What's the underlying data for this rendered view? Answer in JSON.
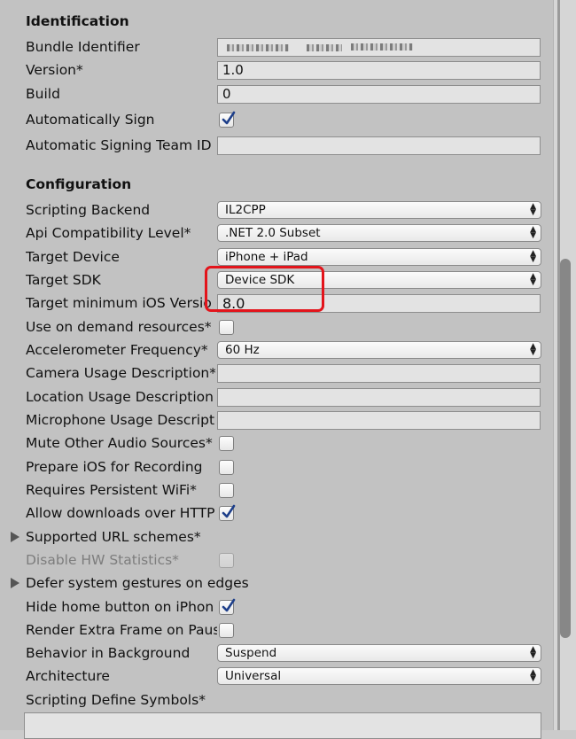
{
  "identification": {
    "heading": "Identification",
    "bundle_identifier": {
      "label": "Bundle Identifier",
      "value": ""
    },
    "version": {
      "label": "Version*",
      "value": "1.0"
    },
    "build": {
      "label": "Build",
      "value": "0"
    },
    "automatically_sign": {
      "label": "Automatically Sign",
      "checked": true
    },
    "signing_team": {
      "label": "Automatic Signing Team ID",
      "value": ""
    }
  },
  "configuration": {
    "heading": "Configuration",
    "scripting_backend": {
      "label": "Scripting Backend",
      "value": "IL2CPP"
    },
    "api_compat": {
      "label": "Api Compatibility Level*",
      "value": ".NET 2.0 Subset"
    },
    "target_device": {
      "label": "Target Device",
      "value": "iPhone + iPad"
    },
    "target_sdk": {
      "label": "Target SDK",
      "value": "Device SDK"
    },
    "target_min_ios": {
      "label": "Target minimum iOS Versio",
      "value": "8.0"
    },
    "on_demand": {
      "label": "Use on demand resources*",
      "checked": false
    },
    "accel_freq": {
      "label": "Accelerometer Frequency*",
      "value": "60 Hz"
    },
    "camera_desc": {
      "label": "Camera Usage Description*",
      "value": ""
    },
    "location_desc": {
      "label": "Location Usage Description",
      "value": ""
    },
    "mic_desc": {
      "label": "Microphone Usage Descript",
      "value": ""
    },
    "mute_audio": {
      "label": "Mute Other Audio Sources*",
      "checked": false
    },
    "prepare_recording": {
      "label": "Prepare iOS for Recording",
      "checked": false
    },
    "persistent_wifi": {
      "label": "Requires Persistent WiFi*",
      "checked": false
    },
    "allow_http": {
      "label": "Allow downloads over HTTP",
      "checked": true
    },
    "url_schemes": {
      "label": "Supported URL schemes*"
    },
    "disable_hw_stats": {
      "label": "Disable HW Statistics*",
      "checked": false
    },
    "defer_gestures": {
      "label": "Defer system gestures on edges"
    },
    "hide_home": {
      "label": "Hide home button on iPhon",
      "checked": true
    },
    "extra_frame": {
      "label": "Render Extra Frame on Paus",
      "checked": false
    },
    "background_behavior": {
      "label": "Behavior in Background",
      "value": "Suspend"
    },
    "architecture": {
      "label": "Architecture",
      "value": "Universal"
    },
    "define_symbols": {
      "label": "Scripting Define Symbols*",
      "value": ""
    }
  },
  "icons": {
    "dropdown": "up-down-arrows",
    "checkmark": "check",
    "foldout": "triangle-right"
  },
  "colors": {
    "highlight": "#e3141b",
    "check": "#1e3f8a"
  }
}
